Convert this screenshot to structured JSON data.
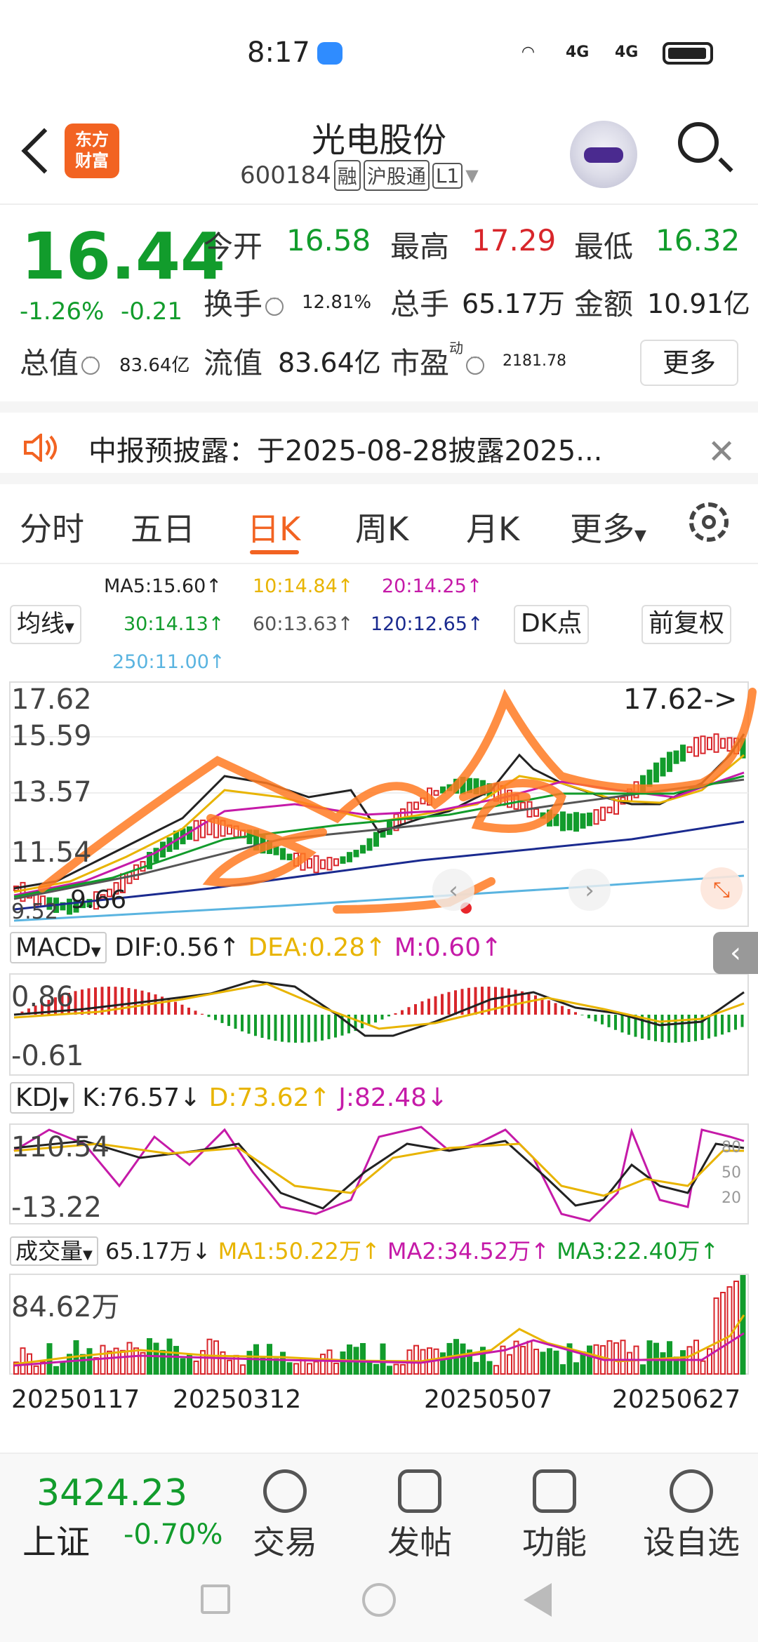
{
  "status": {
    "time": "8:17",
    "net1": "4G",
    "net2": "4G"
  },
  "header": {
    "stock_name": "光电股份",
    "code": "600184",
    "tags": [
      "融",
      "沪股通",
      "L1"
    ],
    "logo_line1": "东方",
    "logo_line2": "财富"
  },
  "quote": {
    "price": "16.44",
    "chg_pct": "-1.26%",
    "chg_abs": "-0.21",
    "open_label": "今开",
    "open": "16.58",
    "high_label": "最高",
    "high": "17.29",
    "low_label": "最低",
    "low": "16.32",
    "turnover_label": "换手",
    "turnover": "12.81%",
    "vol_label": "总手",
    "vol": "65.17万",
    "amount_label": "金额",
    "amount": "10.91亿",
    "mktcap_label": "总值",
    "mktcap": "83.64亿",
    "float_label": "流值",
    "float": "83.64亿",
    "pe_label": "市盈",
    "pe_sup": "动",
    "pe": "2181.78",
    "more": "更多"
  },
  "notice": {
    "text": "中报预披露：于2025-08-28披露2025..."
  },
  "tabs": [
    "分时",
    "五日",
    "日K",
    "周K",
    "月K",
    "更多"
  ],
  "ma": {
    "ma5": "MA5:15.60↑",
    "ma10": "10:14.84↑",
    "ma20": "20:14.25↑",
    "ma30": "30:14.13↑",
    "ma60": "60:13.63↑",
    "ma120": "120:12.65↑",
    "ma250": "250:11.00↑",
    "selector": "均线",
    "dk": "DK点",
    "adjust": "前复权"
  },
  "kchart": {
    "axis": [
      "17.62",
      "15.59",
      "13.57",
      "11.54",
      "9.52"
    ],
    "high_marker": "17.62->",
    "low_marker": "9.66"
  },
  "macd": {
    "selector": "MACD",
    "dif": "DIF:0.56↑",
    "dea": "DEA:0.28↑",
    "m": "M:0.60↑",
    "axis_top": "0.86",
    "axis_bot": "-0.61"
  },
  "kdj": {
    "selector": "KDJ",
    "k": "K:76.57↓",
    "d": "D:73.62↑",
    "j": "J:82.48↓",
    "axis_top": "110.54",
    "axis_bot": "-13.22",
    "r1": "80",
    "r2": "50",
    "r3": "20"
  },
  "volume": {
    "selector": "成交量",
    "vol": "65.17万↓",
    "ma1": "MA1:50.22万↑",
    "ma2": "MA2:34.52万↑",
    "ma3": "MA3:22.40万↑",
    "axis_top": "84.62万"
  },
  "dates": [
    "20250117",
    "20250312",
    "20250507",
    "20250627"
  ],
  "bottom": {
    "index_val": "3424.23",
    "index_name": "上证",
    "index_chg": "-0.70%",
    "nav": [
      "交易",
      "发帖",
      "功能",
      "设自选"
    ]
  },
  "colors": {
    "down": "#129c2c",
    "up": "#d8262b",
    "accent": "#f26322",
    "ma10": "#e8b400",
    "ma20": "#c51aa8",
    "ma120": "#1a2a8f",
    "ma250": "#5ab4e0"
  }
}
